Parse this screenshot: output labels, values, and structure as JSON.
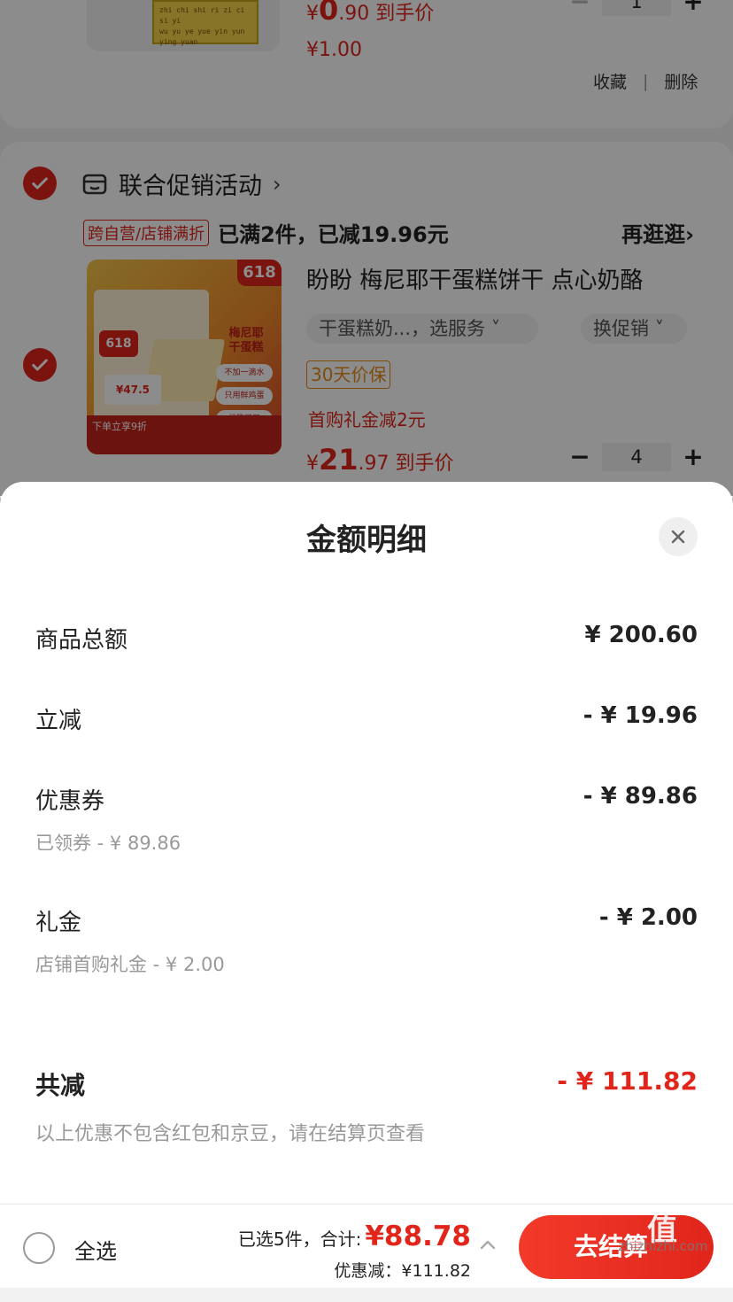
{
  "cart": {
    "top_item": {
      "thumb_text": [
        "zhi chi shi ri zi ci si yi",
        "wu yu ye yue yin yun",
        "ying yuan"
      ],
      "price_prefix": "¥",
      "price_int": "0",
      "price_dec": ".90",
      "price_suffix": " 到手价",
      "original_price": "¥1.00",
      "quantity": "1",
      "collect_label": "收藏",
      "delete_label": "删除",
      "divider": "|"
    },
    "promo_group": {
      "title": "联合促销活动",
      "chevron": "›",
      "tag": "跨自营/店铺满折",
      "status": "已满2件，已减19.96元",
      "more": "再逛逛›",
      "product": {
        "image_corner": "618",
        "image_label": "梅尼耶 干蛋糕",
        "image_badge": "618",
        "image_hand_price": "¥47.5",
        "image_pills": [
          "不加一滴水",
          "只用鲜鸡蛋",
          "松脆可口"
        ],
        "image_footer": "下单立享9折",
        "title": "盼盼 梅尼耶干蛋糕饼干 点心奶酪",
        "selector_1": "干蛋糕奶...，选服务 ˅",
        "selector_2": "换促销 ˅",
        "guarantee_tag": "30天价保",
        "gift_line": "首购礼金减2元",
        "price_prefix": "¥",
        "price_int": "21",
        "price_dec": ".97",
        "price_suffix": " 到手价",
        "quantity": "4"
      }
    }
  },
  "sheet": {
    "title": "金额明细",
    "rows": [
      {
        "label": "商品总额",
        "value": "¥ 200.60",
        "sub": ""
      },
      {
        "label": "立减",
        "value": "- ¥ 19.96",
        "sub": ""
      },
      {
        "label": "优惠券",
        "value": "- ¥ 89.86",
        "sub": "已领券 - ¥ 89.86"
      },
      {
        "label": "礼金",
        "value": "- ¥ 2.00",
        "sub": "店铺首购礼金 - ¥ 2.00"
      },
      {
        "label": "共减",
        "value": "- ¥ 111.82",
        "sub": "以上优惠不包含红包和京豆，请在结算页查看"
      }
    ]
  },
  "bottom_bar": {
    "select_all": "全选",
    "selected_label": "已选5件，合计:",
    "total": "¥88.78",
    "discount": "优惠减：¥111.82",
    "checkout": "去结算"
  },
  "watermark": {
    "big": "值",
    "small": "zhizhizhi.com"
  },
  "colors": {
    "accent": "#e1251b",
    "orange": "#e58a19",
    "muted": "#999999"
  }
}
